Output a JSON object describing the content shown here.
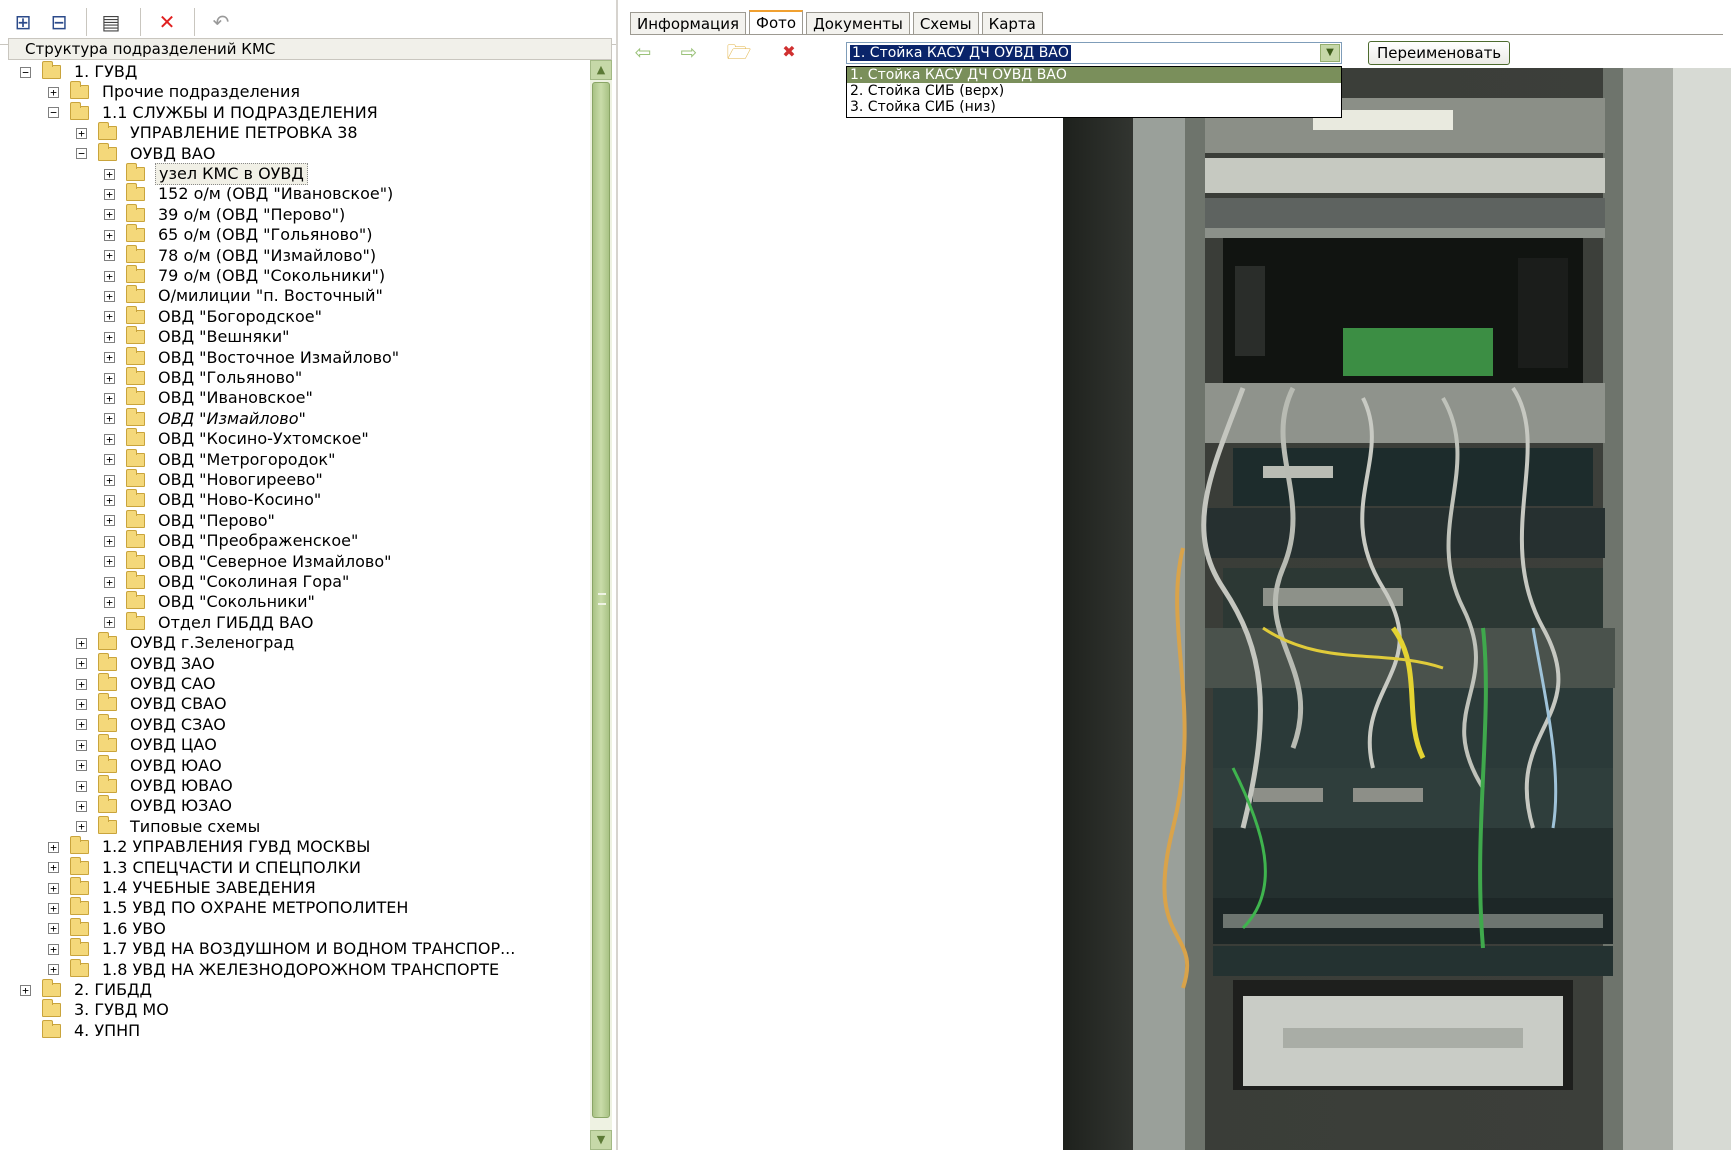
{
  "left_toolbar": {
    "icons": [
      "expand-tree-icon",
      "collapse-tree-icon",
      "properties-icon",
      "delete-icon",
      "undo-icon"
    ]
  },
  "tree_header": "Структура подразделений КМС",
  "tree": [
    {
      "depth": 0,
      "exp": "-",
      "label": "1. ГУВД"
    },
    {
      "depth": 1,
      "exp": "+",
      "label": "Прочие подразделения"
    },
    {
      "depth": 1,
      "exp": "-",
      "label": "1.1 СЛУЖБЫ И ПОДРАЗДЕЛЕНИЯ"
    },
    {
      "depth": 2,
      "exp": "+",
      "label": "УПРАВЛЕНИЕ ПЕТРОВКА 38"
    },
    {
      "depth": 2,
      "exp": "-",
      "label": "ОУВД ВАО"
    },
    {
      "depth": 3,
      "exp": "+",
      "label": "узел КМС в ОУВД",
      "selected": true
    },
    {
      "depth": 3,
      "exp": "+",
      "label": "152 о/м (ОВД \"Ивановское\")"
    },
    {
      "depth": 3,
      "exp": "+",
      "label": "39 о/м (ОВД \"Перово\")"
    },
    {
      "depth": 3,
      "exp": "+",
      "label": "65 о/м (ОВД \"Гольяново\")"
    },
    {
      "depth": 3,
      "exp": "+",
      "label": "78 о/м (ОВД \"Измайлово\")"
    },
    {
      "depth": 3,
      "exp": "+",
      "label": "79 о/м (ОВД \"Сокольники\")"
    },
    {
      "depth": 3,
      "exp": "+",
      "label": "О/милиции \"п. Восточный\""
    },
    {
      "depth": 3,
      "exp": "+",
      "label": "ОВД \"Богородское\""
    },
    {
      "depth": 3,
      "exp": "+",
      "label": "ОВД \"Вешняки\""
    },
    {
      "depth": 3,
      "exp": "+",
      "label": "ОВД \"Восточное Измайлово\""
    },
    {
      "depth": 3,
      "exp": "+",
      "label": "ОВД \"Гольяново\""
    },
    {
      "depth": 3,
      "exp": "+",
      "label": "ОВД \"Ивановское\""
    },
    {
      "depth": 3,
      "exp": "+",
      "label": "ОВД \"Измайлово\"",
      "italic": true
    },
    {
      "depth": 3,
      "exp": "+",
      "label": "ОВД \"Косино-Ухтомское\""
    },
    {
      "depth": 3,
      "exp": "+",
      "label": "ОВД \"Метрогородок\""
    },
    {
      "depth": 3,
      "exp": "+",
      "label": "ОВД \"Новогиреево\""
    },
    {
      "depth": 3,
      "exp": "+",
      "label": "ОВД \"Ново-Косино\""
    },
    {
      "depth": 3,
      "exp": "+",
      "label": "ОВД \"Перово\""
    },
    {
      "depth": 3,
      "exp": "+",
      "label": "ОВД \"Преображенское\""
    },
    {
      "depth": 3,
      "exp": "+",
      "label": "ОВД \"Северное Измайлово\""
    },
    {
      "depth": 3,
      "exp": "+",
      "label": "ОВД \"Соколиная Гора\""
    },
    {
      "depth": 3,
      "exp": "+",
      "label": "ОВД \"Сокольники\""
    },
    {
      "depth": 3,
      "exp": "+",
      "label": "Отдел ГИБДД ВАО"
    },
    {
      "depth": 2,
      "exp": "+",
      "label": "ОУВД г.Зеленоград"
    },
    {
      "depth": 2,
      "exp": "+",
      "label": "ОУВД ЗАО"
    },
    {
      "depth": 2,
      "exp": "+",
      "label": "ОУВД САО"
    },
    {
      "depth": 2,
      "exp": "+",
      "label": "ОУВД СВАО"
    },
    {
      "depth": 2,
      "exp": "+",
      "label": "ОУВД СЗАО"
    },
    {
      "depth": 2,
      "exp": "+",
      "label": "ОУВД ЦАО"
    },
    {
      "depth": 2,
      "exp": "+",
      "label": "ОУВД ЮАО"
    },
    {
      "depth": 2,
      "exp": "+",
      "label": "ОУВД ЮВАО"
    },
    {
      "depth": 2,
      "exp": "+",
      "label": "ОУВД ЮЗАО"
    },
    {
      "depth": 2,
      "exp": "+",
      "label": "Типовые схемы"
    },
    {
      "depth": 1,
      "exp": "+",
      "label": "1.2 УПРАВЛЕНИЯ ГУВД МОСКВЫ"
    },
    {
      "depth": 1,
      "exp": "+",
      "label": "1.3 СПЕЦЧАСТИ И СПЕЦПОЛКИ"
    },
    {
      "depth": 1,
      "exp": "+",
      "label": "1.4 УЧЕБНЫЕ ЗАВЕДЕНИЯ"
    },
    {
      "depth": 1,
      "exp": "+",
      "label": "1.5 УВД ПО ОХРАНЕ МЕТРОПОЛИТЕН"
    },
    {
      "depth": 1,
      "exp": "+",
      "label": "1.6 УВО"
    },
    {
      "depth": 1,
      "exp": "+",
      "label": "1.7 УВД НА ВОЗДУШНОМ И ВОДНОМ ТРАНСПОР..."
    },
    {
      "depth": 1,
      "exp": "+",
      "label": "1.8 УВД НА ЖЕЛЕЗНОДОРОЖНОМ ТРАНСПОРТЕ"
    },
    {
      "depth": 0,
      "exp": "+",
      "label": "2. ГИБДД"
    },
    {
      "depth": 0,
      "exp": "",
      "label": "3. ГУВД МО"
    },
    {
      "depth": 0,
      "exp": "",
      "label": "4. УПНП"
    }
  ],
  "tabs": [
    {
      "label": "Информация",
      "active": false
    },
    {
      "label": "Фото",
      "active": true
    },
    {
      "label": "Документы",
      "active": false
    },
    {
      "label": "Схемы",
      "active": false
    },
    {
      "label": "Карта",
      "active": false
    }
  ],
  "photo_toolbar": {
    "icons": [
      "back-arrow-icon",
      "forward-arrow-icon",
      "open-folder-icon",
      "delete-photo-icon"
    ]
  },
  "photo_select": {
    "value": "1. Стойка КАСУ ДЧ ОУВД ВАО",
    "options": [
      "1. Стойка КАСУ ДЧ ОУВД ВАО",
      "2. Стойка СИБ (верх)",
      "3. Стойка СИБ (низ)"
    ],
    "selected_index": 0
  },
  "rename_label": "Переименовать",
  "colors": {
    "accent": "#f0a030",
    "selection": "#0a246a",
    "scrollbar": "#a9c285"
  }
}
